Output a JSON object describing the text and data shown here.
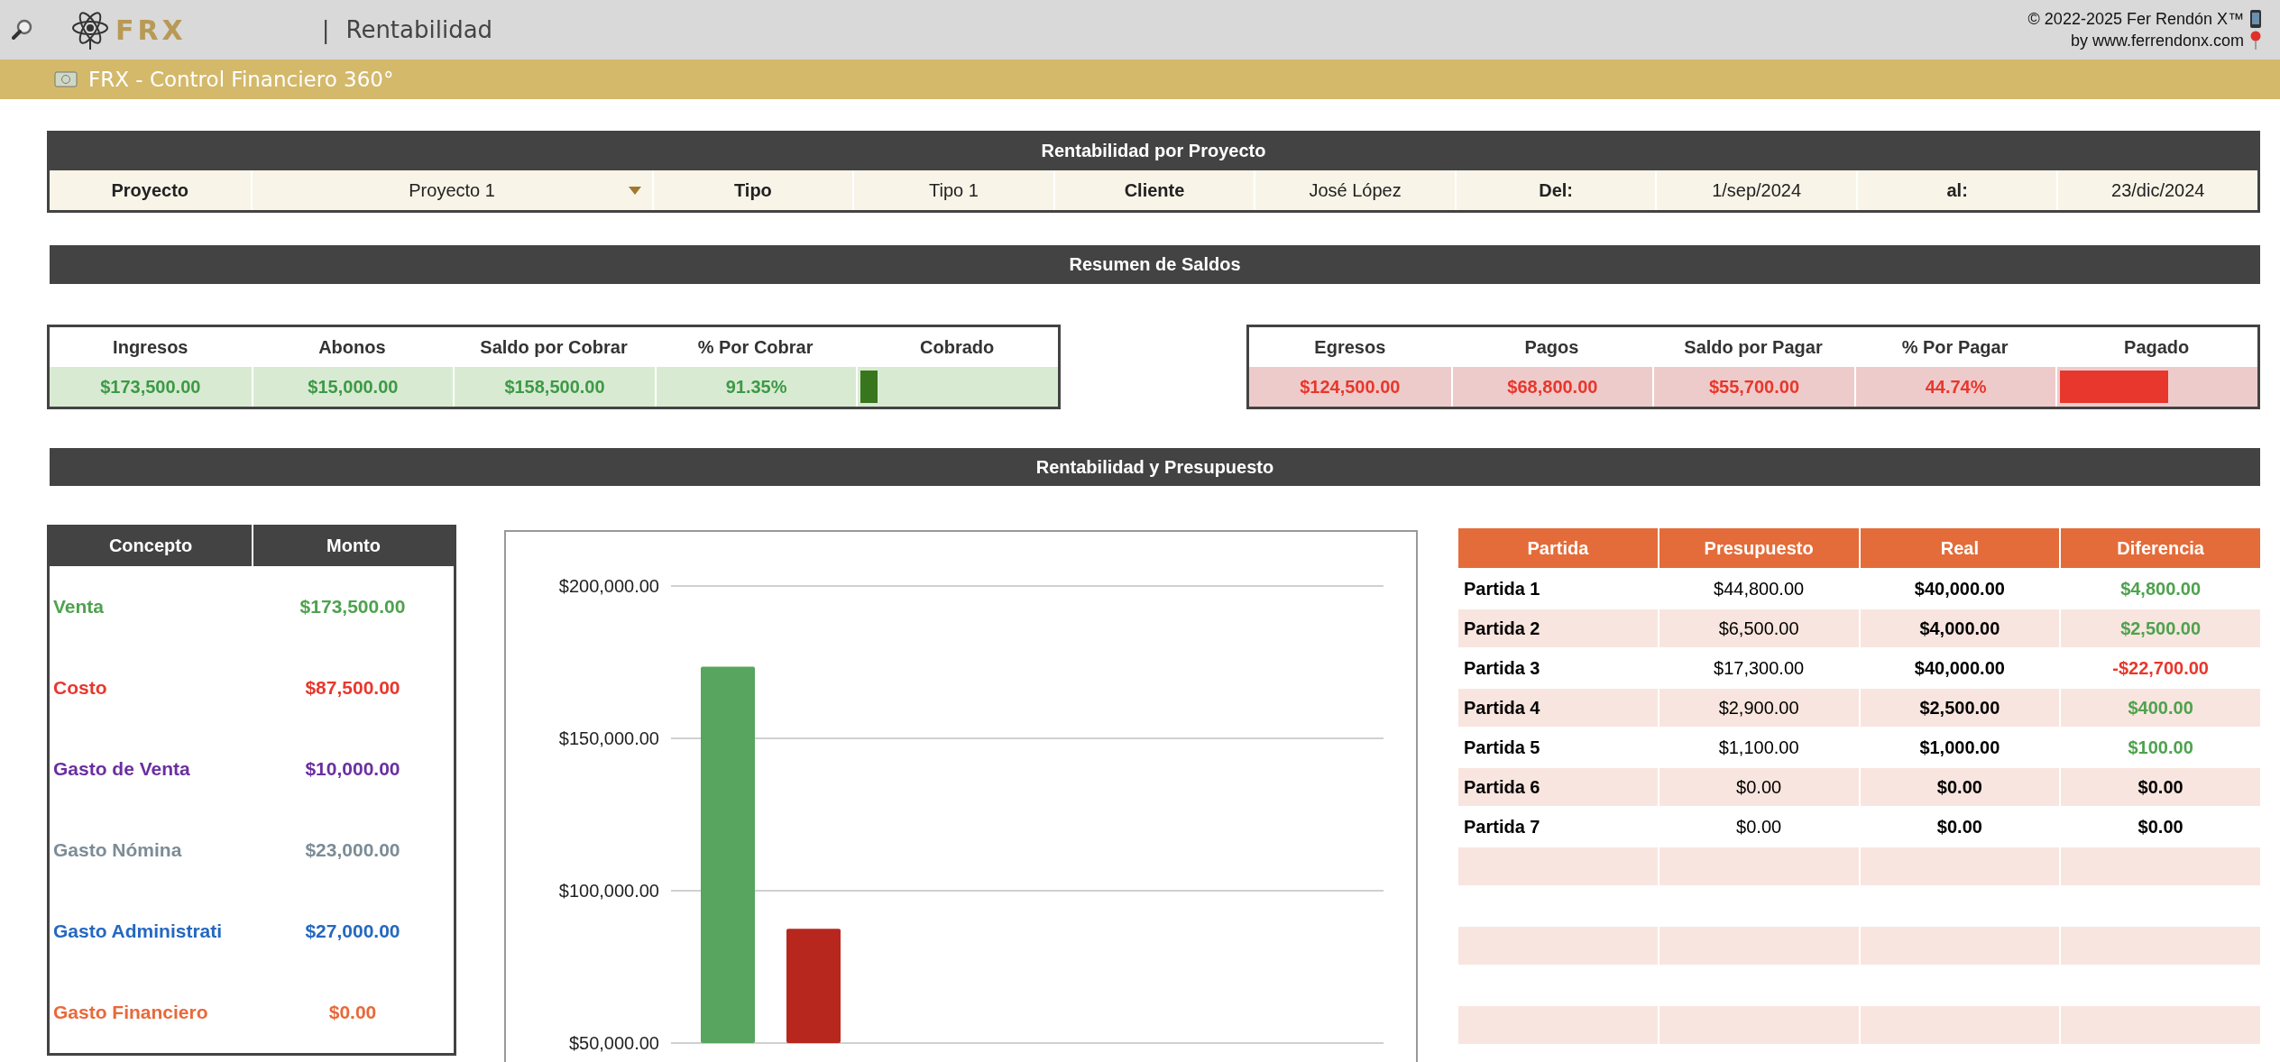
{
  "header": {
    "logo": "FRX",
    "separator": "|",
    "page_title": "Rentabilidad",
    "credits": [
      "© 2022-2025 Fer Rendón X™",
      "by www.ferrendonx.com"
    ]
  },
  "banner": {
    "title": "FRX - Control Financiero 360°"
  },
  "project": {
    "title": "Rentabilidad por Proyecto",
    "fields": [
      {
        "label": "Proyecto",
        "value": "Proyecto 1",
        "kind": "dropdown"
      },
      {
        "label": "Tipo",
        "value": "Tipo 1",
        "kind": "text"
      },
      {
        "label": "Cliente",
        "value": "José López",
        "kind": "text"
      },
      {
        "label": "Del:",
        "value": "1/sep/2024",
        "kind": "text"
      },
      {
        "label": "al:",
        "value": "23/dic/2024",
        "kind": "text"
      }
    ]
  },
  "saldos": {
    "title": "Resumen de Saldos",
    "tables": [
      {
        "kind": "income",
        "columns": [
          "Ingresos",
          "Abonos",
          "Saldo por Cobrar",
          "% Por Cobrar",
          "Cobrado"
        ],
        "values": [
          "$173,500.00",
          "$15,000.00",
          "$158,500.00",
          "91.35%"
        ],
        "level": 0.0865
      },
      {
        "kind": "expense",
        "columns": [
          "Egresos",
          "Pagos",
          "Saldo por Pagar",
          "% Por Pagar",
          "Pagado"
        ],
        "values": [
          "$124,500.00",
          "$68,800.00",
          "$55,700.00",
          "44.74%"
        ],
        "level": 0.5526
      }
    ]
  },
  "rentabilidad": {
    "title": "Rentabilidad y Presupuesto",
    "concepts": {
      "columns": [
        "Concepto",
        "Monto"
      ],
      "rows": [
        {
          "concepto": "Venta",
          "monto": "$173,500.00",
          "color": "#4ea24e"
        },
        {
          "concepto": "Costo",
          "monto": "$87,500.00",
          "color": "#e8372c"
        },
        {
          "concepto": "Gasto de Venta",
          "monto": "$10,000.00",
          "color": "#6a2fa0"
        },
        {
          "concepto": "Gasto Nómina",
          "monto": "$23,000.00",
          "color": "#7c8c96"
        },
        {
          "concepto": "Gasto Administrati",
          "monto": "$27,000.00",
          "color": "#2468c0"
        },
        {
          "concepto": "Gasto Financiero",
          "monto": "$0.00",
          "color": "#e8693a"
        }
      ]
    },
    "chart_data": {
      "type": "bar",
      "grid": true,
      "ylim": [
        50000,
        200000
      ],
      "yticks": [
        {
          "value": 50000,
          "label": "$50,000.00"
        },
        {
          "value": 100000,
          "label": "$100,000.00"
        },
        {
          "value": 150000,
          "label": "$150,000.00"
        },
        {
          "value": 200000,
          "label": "$200,000.00"
        }
      ],
      "series": [
        {
          "color": "#57a55f",
          "values": [
            173500
          ]
        },
        {
          "color": "#b8271e",
          "values": [
            87500
          ]
        }
      ]
    },
    "budget": {
      "columns": [
        "Partida",
        "Presupuesto",
        "Real",
        "Diferencia"
      ],
      "rows": [
        {
          "partida": "Partida 1",
          "presupuesto": "$44,800.00",
          "real": "$40,000.00",
          "diferencia": "$4,800.00",
          "color": "#4ea24e"
        },
        {
          "partida": "Partida 2",
          "presupuesto": "$6,500.00",
          "real": "$4,000.00",
          "diferencia": "$2,500.00",
          "color": "#4ea24e"
        },
        {
          "partida": "Partida 3",
          "presupuesto": "$17,300.00",
          "real": "$40,000.00",
          "diferencia": "-$22,700.00",
          "color": "#e8372c"
        },
        {
          "partida": "Partida 4",
          "presupuesto": "$2,900.00",
          "real": "$2,500.00",
          "diferencia": "$400.00",
          "color": "#4ea24e"
        },
        {
          "partida": "Partida 5",
          "presupuesto": "$1,100.00",
          "real": "$1,000.00",
          "diferencia": "$100.00",
          "color": "#4ea24e"
        },
        {
          "partida": "Partida 6",
          "presupuesto": "$0.00",
          "real": "$0.00",
          "diferencia": "$0.00",
          "color": "#000000"
        },
        {
          "partida": "Partida 7",
          "presupuesto": "$0.00",
          "real": "$0.00",
          "diferencia": "$0.00",
          "color": "#000000"
        }
      ]
    }
  }
}
